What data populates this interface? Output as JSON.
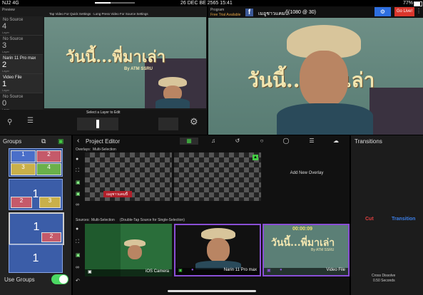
{
  "status": {
    "carrier": "NJ2 4G",
    "datetime": "26 DEC BE 2565 15:41",
    "battery": "77%"
  },
  "preview": {
    "label": "Preview",
    "hint": "Tap Video For Quick Settings · Long Press Video For Source Settings",
    "select_layer": "Select a Layer to Edit",
    "scene_title": "วันนี้...พี่มาเล่า",
    "scene_sub": "By ATM SSRU"
  },
  "layers": [
    {
      "num": "4",
      "label": "No Source",
      "sub": "Layer"
    },
    {
      "num": "3",
      "label": "No Source",
      "sub": "Layer"
    },
    {
      "num": "2",
      "label": "Narin 11 Pro max",
      "sub": "Layer"
    },
    {
      "num": "1",
      "label": "Video File",
      "sub": "Layer"
    },
    {
      "num": "0",
      "label": "No Source",
      "sub": "Layer"
    }
  ],
  "program": {
    "label": "Program",
    "free_trial": "Free Trial Available",
    "channel_name": "เมอูชาวแคมปิ้",
    "resolution": "(1080 @ 30)",
    "go_live": "Go Live!",
    "scene_title": "วันนี้...พี่มาเล่า"
  },
  "groups": {
    "title": "Groups",
    "use_groups_label": "Use Groups",
    "use_groups_on": true,
    "tiles": [
      {
        "a": "1",
        "b": "2",
        "c": "3",
        "d": "4"
      },
      {
        "a": "1",
        "b": "2",
        "c": "3"
      },
      {
        "a": "1",
        "b": "2"
      },
      {
        "a": "1"
      }
    ]
  },
  "editor": {
    "title": "Project Editor",
    "overlays_label": "Overlays:",
    "overlays_mode": "Multi-Selection",
    "add_overlay": "Add New Overlay",
    "overlay_lower_third": "เมอูชาวแคมปิ้",
    "sources_label": "Sources:",
    "sources_mode": "Multi-Selection",
    "sources_hint": "(Double-Tap Source for Single-Selection)",
    "sources": [
      {
        "name": "iOS Camera"
      },
      {
        "name": "Narin 11 Pro max"
      },
      {
        "name": "Video File",
        "timecode": "00:00:09"
      }
    ]
  },
  "transitions": {
    "title": "Transitions",
    "cut": "Cut",
    "transition": "Transition",
    "mode": "Cross Dissolve",
    "duration": "0.50 Seconds"
  },
  "colors": {
    "go_live": "#d9362c",
    "accent_blue": "#2e6fe0",
    "cut_red": "#e04040",
    "transition_blue": "#3c7fe8",
    "selected_border": "#8a4fd6",
    "toggle_green": "#4cd964"
  }
}
